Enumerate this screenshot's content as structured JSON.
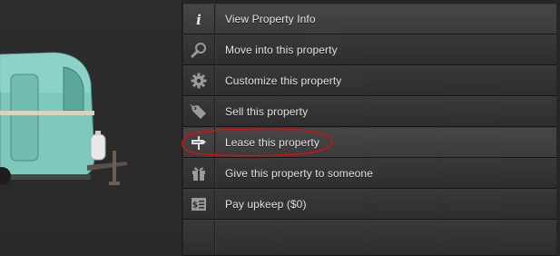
{
  "context_menu": {
    "items": [
      {
        "label": "View Property Info",
        "icon": "info-icon"
      },
      {
        "label": "Move into this property",
        "icon": "magnifier-icon"
      },
      {
        "label": "Customize this property",
        "icon": "gear-icon"
      },
      {
        "label": "Sell this property",
        "icon": "price-tag-icon"
      },
      {
        "label": "Lease this property",
        "icon": "signpost-icon"
      },
      {
        "label": "Give this property to someone",
        "icon": "gift-icon"
      },
      {
        "label": "Pay upkeep ($0)",
        "icon": "bill-icon"
      }
    ]
  },
  "colors": {
    "annotation_circle": "#d11010",
    "trailer_body": "#7fc8bd",
    "menu_text": "#e4e4e4"
  }
}
